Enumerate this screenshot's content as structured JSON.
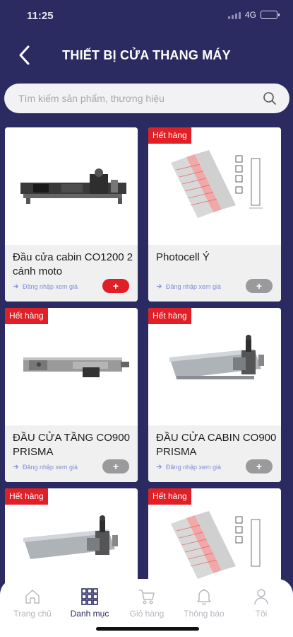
{
  "status": {
    "time": "11:25",
    "network": "4G"
  },
  "header": {
    "title": "THIẾT BỊ CỬA THANG MÁY"
  },
  "search": {
    "placeholder": "Tìm kiếm sản phẩm, thương hiệu"
  },
  "products": [
    {
      "name": "Đầu cửa cabin CO1200 2 cánh moto",
      "badge": "",
      "login_text": "Đăng nhập xem giá",
      "add_label": "+",
      "image_icon": "door-operator-image"
    },
    {
      "name": "Photocell Ý",
      "badge": "Hết hàng",
      "login_text": "Đăng nhập xem giá",
      "add_label": "+",
      "image_icon": "photocell-image"
    },
    {
      "name": "ĐẦU CỬA TẦNG CO900 PRISMA",
      "badge": "Hết hàng",
      "login_text": "Đăng nhập xem giá",
      "add_label": "+",
      "image_icon": "door-operator-image"
    },
    {
      "name": "ĐẦU CỬA CABIN CO900 PRISMA",
      "badge": "Hết hàng",
      "login_text": "Đăng nhập xem giá",
      "add_label": "+",
      "image_icon": "door-operator-image"
    },
    {
      "name": "",
      "badge": "Hết hàng",
      "login_text": "",
      "add_label": "",
      "image_icon": "door-operator-image"
    },
    {
      "name": "",
      "badge": "Hết hàng",
      "login_text": "",
      "add_label": "",
      "image_icon": "photocell-image"
    }
  ],
  "nav": [
    {
      "label": "Trang chủ",
      "icon": "home-icon",
      "active": false
    },
    {
      "label": "Danh mục",
      "icon": "grid-icon",
      "active": true
    },
    {
      "label": "Giỏ hàng",
      "icon": "cart-icon",
      "active": false
    },
    {
      "label": "Thông báo",
      "icon": "bell-icon",
      "active": false
    },
    {
      "label": "Tôi",
      "icon": "user-icon",
      "active": false
    }
  ],
  "colors": {
    "background": "#2b2b62",
    "accent_red": "#e01f26",
    "nav_active": "#2d2d63"
  }
}
